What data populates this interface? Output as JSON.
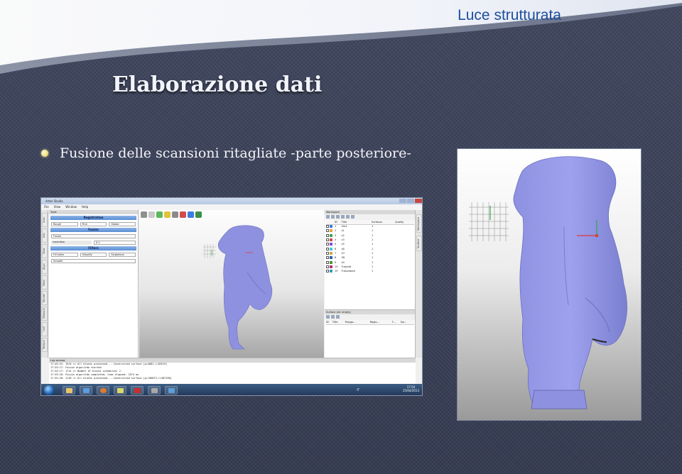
{
  "slide": {
    "header": "Luce strutturata",
    "title": "Elaborazione dati",
    "bullet": "Fusione delle scansioni ritagliate -parte posteriore-"
  },
  "app": {
    "window_title": "Artec Studio",
    "menu": [
      "File",
      "View",
      "Window",
      "Help"
    ],
    "left_tabs": [
      "Scan",
      "Edit",
      "Tools",
      "Align",
      "Mesh",
      "Render",
      "Measure",
      "Hull",
      "Texture"
    ],
    "tools_panel": {
      "header": "Tools",
      "registration_label": "Registration",
      "registration_controls": [
        "Rough",
        "Fine",
        "Global"
      ],
      "fusion_label": "Fusion",
      "fusion_type": "Fusion",
      "resolution_label": "resolution",
      "resolution_value": "0.1",
      "filters_label": "Filters",
      "filter_controls": [
        "Fill holes",
        "Simplify",
        "Singletons"
      ],
      "smooth": "Smooth"
    },
    "right_tabs": [
      "Workspace",
      "Surface"
    ],
    "workspace": {
      "header": "Workspace",
      "columns": [
        "ID",
        "Title",
        "Surfaces",
        "Quality"
      ],
      "rows": [
        {
          "id": "1",
          "title": "Sm4",
          "surfaces": "1",
          "color": "#3b7de0"
        },
        {
          "id": "2",
          "title": "s1",
          "surfaces": "1",
          "color": "#e0a53b"
        },
        {
          "id": "3",
          "title": "s2",
          "surfaces": "1",
          "color": "#3ba54a"
        },
        {
          "id": "4",
          "title": "s3",
          "surfaces": "1",
          "color": "#d24a4a"
        },
        {
          "id": "5",
          "title": "s5",
          "surfaces": "1",
          "color": "#8a4ad2"
        },
        {
          "id": "6",
          "title": "s6",
          "surfaces": "1",
          "color": "#4ac4d2"
        },
        {
          "id": "7",
          "title": "S7",
          "surfaces": "1",
          "color": "#d2a64a"
        },
        {
          "id": "8",
          "title": "S8",
          "surfaces": "1",
          "color": "#2d5fb8"
        },
        {
          "id": "9",
          "title": "s9",
          "surfaces": "1",
          "color": "#4a9a2d"
        },
        {
          "id": "15",
          "title": "Fusion6",
          "surfaces": "1",
          "color": "#b82d7c"
        },
        {
          "id": "19",
          "title": "Fusionback",
          "surfaces": "1",
          "color": "#2da0b8"
        }
      ]
    },
    "surface_panel": {
      "header": "Surface (all: empty)",
      "columns": [
        "ID",
        "Title",
        "Polygo...",
        "Regio...",
        "T...",
        "Sw..."
      ]
    },
    "log": {
      "header": "Log window",
      "lines": [
        "17:49:32: 19/8 >> All blocks processed... Constructed surface [p=4082,l=83519]",
        "17:53:17: Fusion algorithm started",
        "17:53:17: 1714 >> Number of blocks scheduled: 2",
        "17:53:20: Fusion algorithm completed, time elapsed: 2574 ms",
        "17:53:20: 1/48 >> All blocks processed... Constructed surface [p=196873,l=387198]"
      ]
    },
    "taskbar": {
      "lang": "IT",
      "time": "17:54",
      "date": "25/04/2013",
      "apps": [
        "explorer",
        "media",
        "firefox",
        "file",
        "pdf",
        "tool",
        "artec"
      ]
    },
    "colors": {
      "section_bar": "#5a8ed5",
      "model": "#8d91df",
      "taskbar": "#1f3556"
    }
  }
}
